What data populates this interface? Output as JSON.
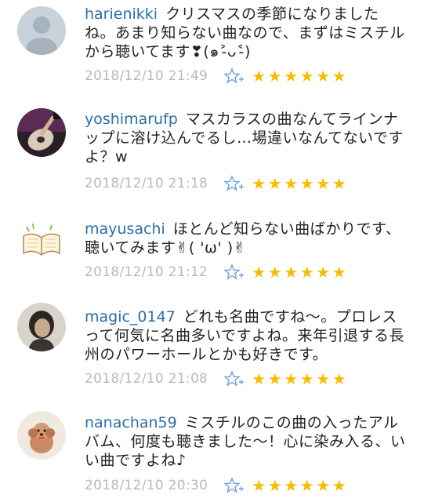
{
  "comments": [
    {
      "username": "harienikki",
      "text": "クリスマスの季節になりましたね。あまり知らない曲なので、まずはミスチルから聴いてます❣(๑˃̵ᴗ˂̵)",
      "timestamp": "2018/12/10 21:49",
      "avatar_icon": "default-user-icon",
      "stars": [
        "★",
        "★",
        "★",
        "★",
        "★",
        "★"
      ]
    },
    {
      "username": "yoshimarufp",
      "text": "マスカラスの曲なんてラインナップに溶け込んでるし…場違いなんてないですよ？w",
      "timestamp": "2018/12/10 21:18",
      "avatar_icon": "guitar-photo",
      "stars": [
        "★",
        "★",
        "★",
        "★",
        "★",
        "★"
      ]
    },
    {
      "username": "mayusachi",
      "text": "ほとんど知らない曲ばかりです、聴いてみます✌( 'ω' )✌",
      "timestamp": "2018/12/10 21:12",
      "avatar_icon": "open-book-icon",
      "stars": [
        "★",
        "★",
        "★",
        "★",
        "★",
        "★"
      ]
    },
    {
      "username": "magic_0147",
      "text": "どれも名曲ですね〜。プロレスって何気に名曲多いですよね。来年引退する長州のパワーホールとかも好きです。",
      "timestamp": "2018/12/10 21:08",
      "avatar_icon": "person-photo",
      "stars": [
        "★",
        "★",
        "★",
        "★",
        "★",
        "★"
      ]
    },
    {
      "username": "nanachan59",
      "text": "ミスチルのこの曲の入ったアルバム、何度も聴きました〜！心に染み入る、いい曲ですよね♪",
      "timestamp": "2018/12/10 20:30",
      "avatar_icon": "dog-photo",
      "stars": [
        "★",
        "★",
        "★",
        "★",
        "★",
        "★"
      ]
    }
  ],
  "colors": {
    "username": "#2b6fa8",
    "star": "#f5bd00",
    "timestamp": "#b9b9b9",
    "add_star": "#6fa0d8"
  }
}
